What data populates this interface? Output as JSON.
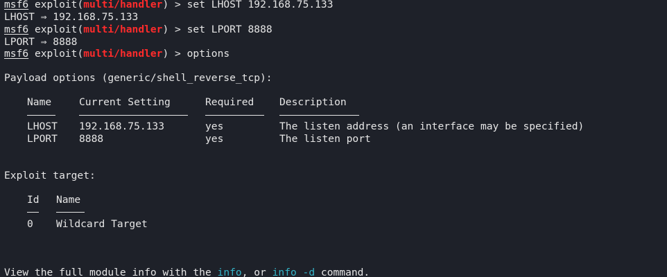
{
  "session": {
    "prompt_user": "msf6",
    "exploit_word": "exploit(",
    "module": "multi/handler",
    "prompt_suffix": ") > ",
    "commands": [
      {
        "cmd": "set LHOST 192.168.75.133",
        "result": "LHOST ⇒ 192.168.75.133"
      },
      {
        "cmd": "set LPORT 8888",
        "result": "LPORT ⇒ 8888"
      },
      {
        "cmd": "options",
        "result": ""
      }
    ]
  },
  "payload_options": {
    "title": "Payload options (generic/shell_reverse_tcp):",
    "columns": [
      "Name",
      "Current Setting",
      "Required",
      "Description"
    ],
    "rows": [
      {
        "name": "LHOST",
        "current": "192.168.75.133",
        "required": "yes",
        "description": "The listen address (an interface may be specified)"
      },
      {
        "name": "LPORT",
        "current": "8888",
        "required": "yes",
        "description": "The listen port"
      }
    ]
  },
  "exploit_target": {
    "title": "Exploit target:",
    "columns": [
      "Id",
      "Name"
    ],
    "rows": [
      {
        "id": "0",
        "name": "Wildcard Target"
      }
    ]
  },
  "footer": {
    "prefix": "View the full module info with the ",
    "link1": "info",
    "middle": ", or ",
    "link2": "info -d",
    "suffix": " command."
  },
  "colors": {
    "background": "#1e2129",
    "text": "#e6e6e6",
    "module_red": "#ff2b2b",
    "link_cyan": "#34b4c8"
  }
}
